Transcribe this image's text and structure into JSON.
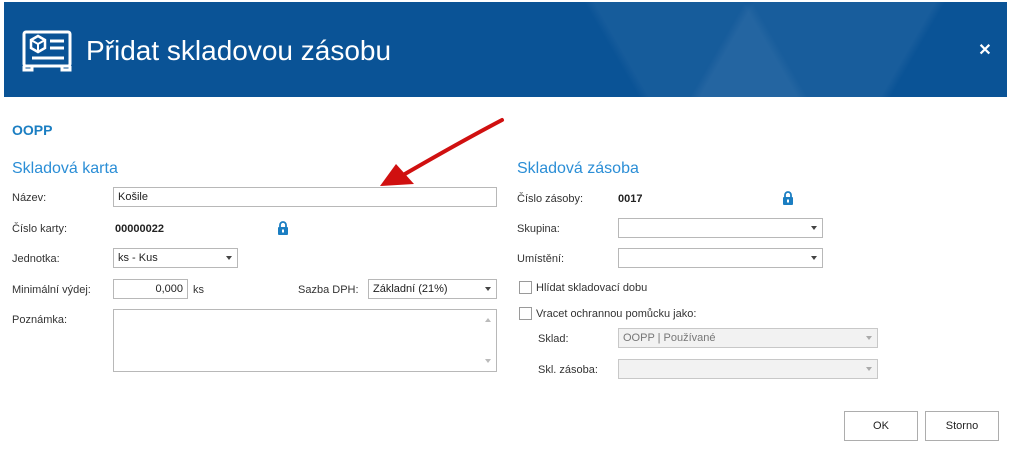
{
  "dialog": {
    "title": "Přidat skladovou zásobu",
    "close_symbol": "✕",
    "section_code": "OOPP"
  },
  "left": {
    "title": "Skladová karta",
    "nazev_label": "Název:",
    "nazev_value": "Košile",
    "cislo_karty_label": "Číslo karty:",
    "cislo_karty_value": "00000022",
    "jednotka_label": "Jednotka:",
    "jednotka_value": "ks - Kus",
    "min_vydej_label": "Minimální výdej:",
    "min_vydej_value": "0,000",
    "min_vydej_unit": "ks",
    "sazba_dph_label": "Sazba DPH:",
    "sazba_dph_value": "Základní (21%)",
    "poznamka_label": "Poznámka:",
    "poznamka_value": ""
  },
  "right": {
    "title": "Skladová zásoba",
    "cislo_zasoby_label": "Číslo zásoby:",
    "cislo_zasoby_value": "0017",
    "skupina_label": "Skupina:",
    "skupina_value": "",
    "umisteni_label": "Umístění:",
    "umisteni_value": "",
    "hlidat_label": "Hlídat skladovací dobu",
    "hlidat_checked": false,
    "vracet_label": "Vracet ochrannou pomůcku jako:",
    "vracet_checked": false,
    "sklad_label": "Sklad:",
    "sklad_value": "OOPP | Používané",
    "skl_zasoba_label": "Skl. zásoba:",
    "skl_zasoba_value": ""
  },
  "buttons": {
    "ok": "OK",
    "storno": "Storno"
  },
  "colors": {
    "header_bg": "#0a5396",
    "accent_blue": "#2b8ed6",
    "annotation_red": "#d01010"
  },
  "icons": {
    "header": "inventory-box-icon",
    "lock": "lock-icon",
    "annotation": "red-arrow-annotation"
  }
}
